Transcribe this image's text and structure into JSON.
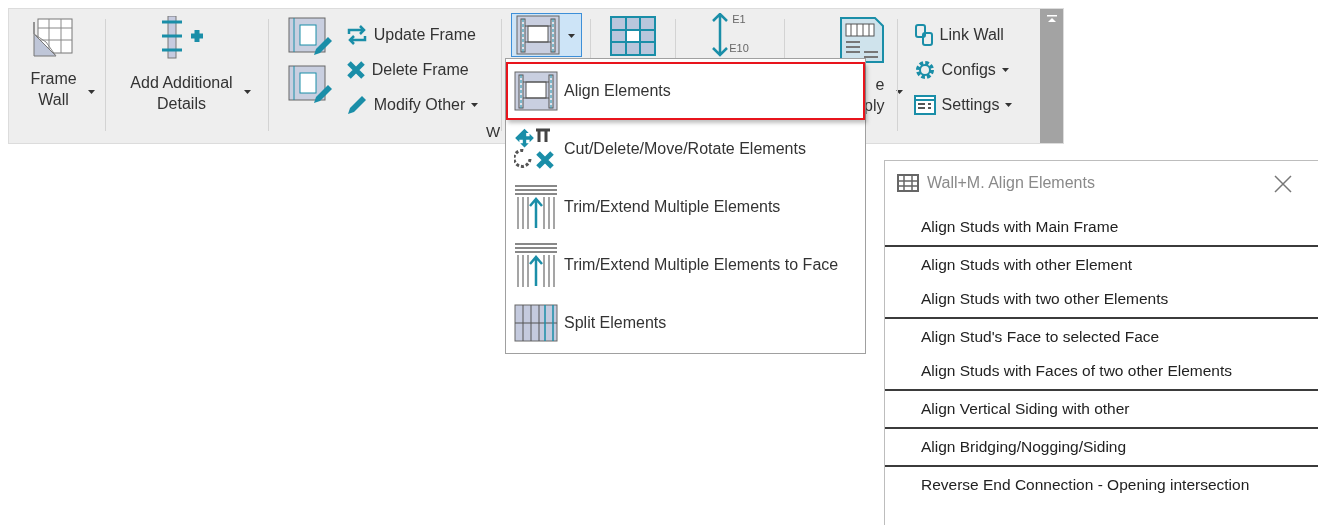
{
  "ribbon": {
    "items": [
      {
        "kind": "large",
        "label_lines": [
          "Frame",
          "Wall"
        ],
        "has_menu": true
      },
      {
        "kind": "large",
        "label_lines": [
          "Add Additional",
          "Details"
        ],
        "has_menu": true
      },
      {
        "kind": "stack",
        "buttons": [
          {
            "label": "Update Frame",
            "has_menu": false
          },
          {
            "label": "Delete Frame",
            "has_menu": false
          },
          {
            "label": "Modify Other",
            "has_menu": true
          }
        ]
      },
      {
        "kind": "split",
        "expanded": true,
        "has_menu": true
      },
      {
        "kind": "large",
        "has_menu": false
      },
      {
        "kind": "numbering",
        "marks": [
          "E1",
          "E10"
        ]
      },
      {
        "kind": "large",
        "label_lines": [
          "e",
          "ply"
        ],
        "has_menu": true
      },
      {
        "kind": "stack",
        "buttons": [
          {
            "label": "Link Wall",
            "has_menu": false
          },
          {
            "label": "Configs",
            "has_menu": true
          },
          {
            "label": "Settings",
            "has_menu": true
          }
        ]
      }
    ],
    "panel_label": "W"
  },
  "menu": {
    "items": [
      {
        "label": "Align Elements",
        "selected": true
      },
      {
        "label": "Cut/Delete/Move/Rotate Elements",
        "selected": false
      },
      {
        "label": "Trim/Extend Multiple Elements",
        "selected": false
      },
      {
        "label": "Trim/Extend Multiple Elements to Face",
        "selected": false
      },
      {
        "label": "Split Elements",
        "selected": false
      }
    ]
  },
  "dialog": {
    "title": "Wall+M. Align Elements",
    "groups": [
      {
        "items": [
          "Align Studs with Main Frame"
        ]
      },
      {
        "items": [
          "Align Studs with other Element",
          "Align Studs with two other Elements"
        ]
      },
      {
        "items": [
          "Align Stud's Face to selected Face",
          "Align Studs with Faces of two other Elements"
        ]
      },
      {
        "items": [
          "Align Vertical Siding with other"
        ]
      },
      {
        "items": [
          "Align Bridging/Nogging/Siding"
        ]
      },
      {
        "items": [
          "Reverse End Connection - Opening intersection"
        ]
      }
    ]
  }
}
